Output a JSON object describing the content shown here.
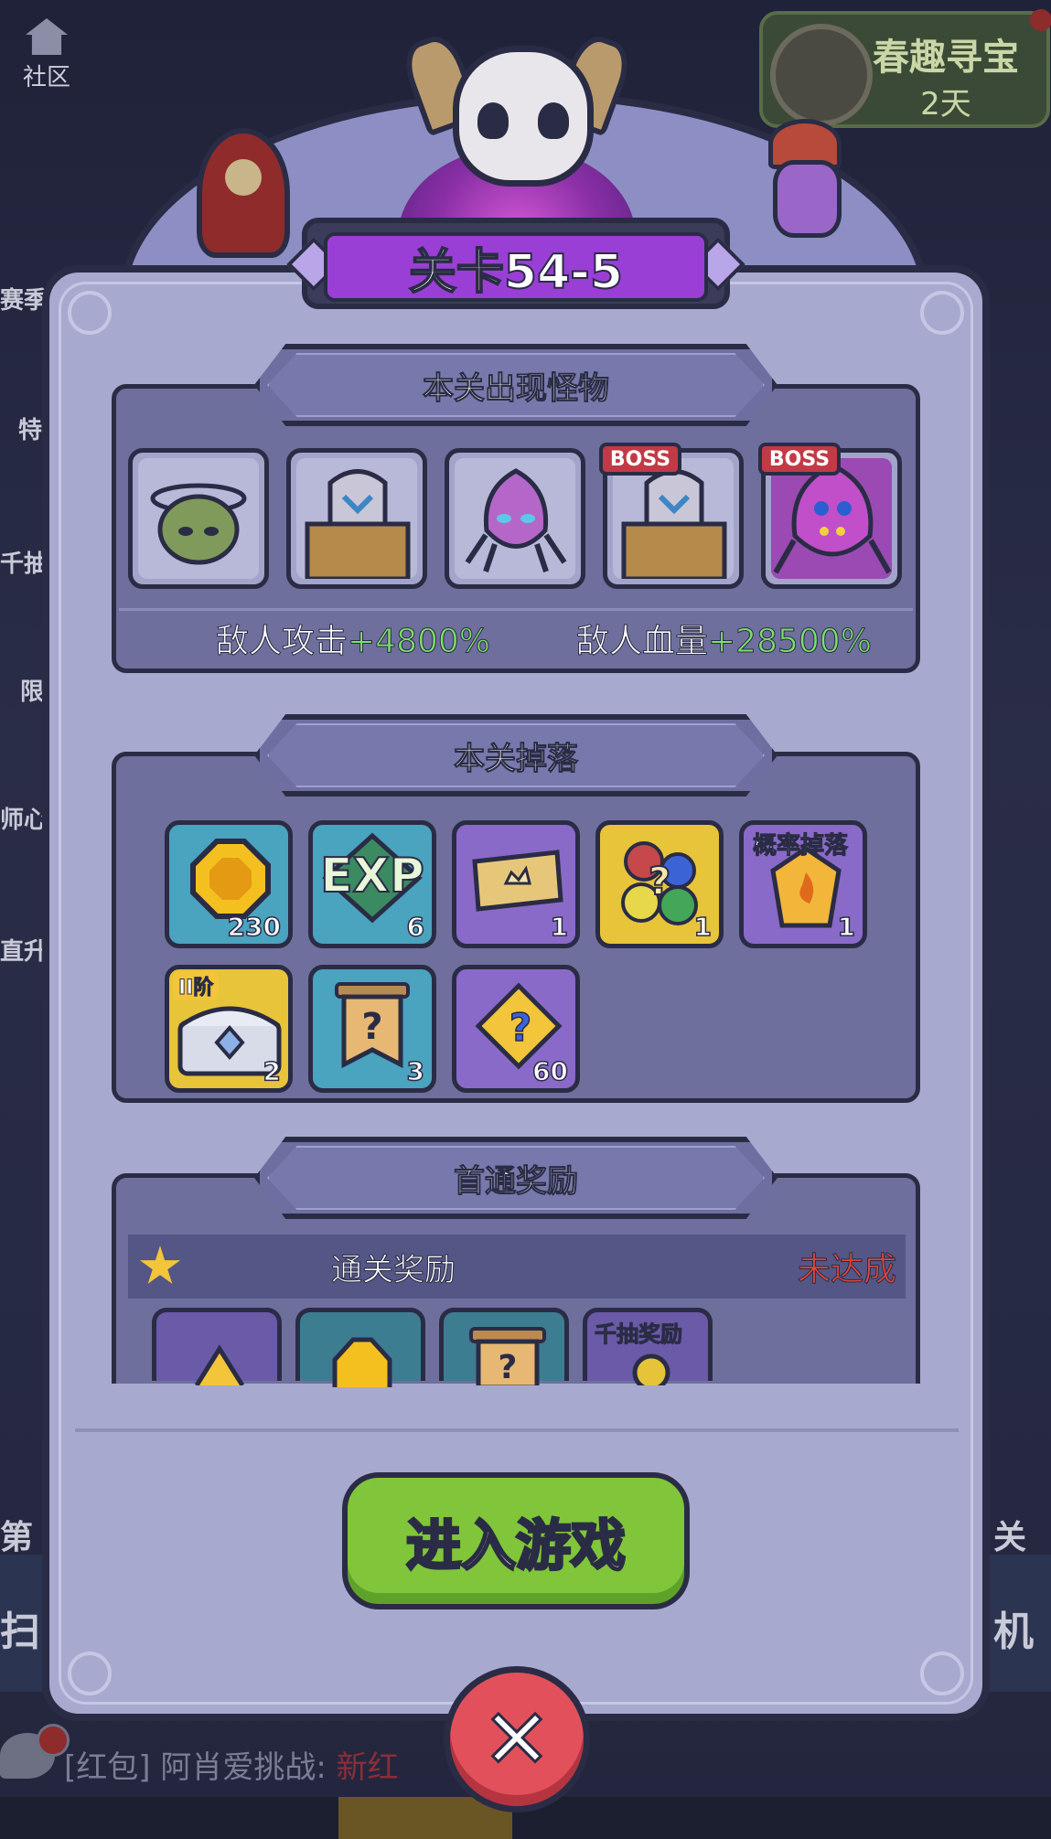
{
  "background": {
    "community_label": "社区",
    "event": {
      "title": "春趣寻宝",
      "subtitle": "2天"
    },
    "side_labels": [
      "赛季",
      "特",
      "千抽",
      "限",
      "师心",
      "直升"
    ],
    "left_stage_hint": "第",
    "right_stage_hint": "关",
    "left_button_hint": "扫",
    "right_button_hint": "机",
    "chat": {
      "tag": "[红包]",
      "text": "阿肖爱挑战:",
      "highlight": "新红"
    }
  },
  "dialog": {
    "title": "关卡54-5",
    "monsters_section": {
      "header": "本关出现怪物",
      "monsters": [
        {
          "icon": "green-slime-monster-icon",
          "boss": false
        },
        {
          "icon": "armored-knight-monster-icon",
          "boss": false
        },
        {
          "icon": "purple-spider-monster-icon",
          "boss": false
        },
        {
          "icon": "armored-knight-boss-icon",
          "boss": true,
          "tag": "BOSS"
        },
        {
          "icon": "purple-spider-boss-icon",
          "boss": true,
          "tag": "BOSS"
        }
      ],
      "attack_label": "敌人攻击",
      "attack_value": "+4800%",
      "hp_label": "敌人血量",
      "hp_value": "+28500%"
    },
    "drops_section": {
      "header": "本关掉落",
      "items": [
        {
          "icon": "gold-coin-icon",
          "count": "230",
          "color": "#4aa3bf"
        },
        {
          "icon": "exp-icon",
          "label": "EXP",
          "count": "6",
          "color": "#4aa3bf"
        },
        {
          "icon": "ticket-icon",
          "count": "1",
          "color": "#8a6ac8"
        },
        {
          "icon": "mystery-gems-icon",
          "count": "1",
          "color": "#e7c43a"
        },
        {
          "icon": "flame-crystal-icon",
          "count": "1",
          "color": "#8a6ac8",
          "tag": "概率掉落"
        },
        {
          "icon": "silver-chest-icon",
          "count": "2",
          "color": "#e7c43a",
          "tag": "II阶"
        },
        {
          "icon": "mystery-scroll-icon",
          "count": "3",
          "color": "#4aa3bf"
        },
        {
          "icon": "mystery-puzzle-icon",
          "count": "60",
          "color": "#8a6ac8"
        }
      ]
    },
    "first_clear_section": {
      "header": "首通奖励",
      "row_title": "通关奖励",
      "status": "未达成",
      "items": [
        {
          "icon": "puzzle-piece-icon"
        },
        {
          "icon": "gold-coin-icon"
        },
        {
          "icon": "mystery-scroll-icon"
        },
        {
          "icon": "key-icon",
          "tag": "千抽奖励"
        }
      ]
    },
    "enter_button": "进入游戏",
    "close_button": "✕"
  }
}
